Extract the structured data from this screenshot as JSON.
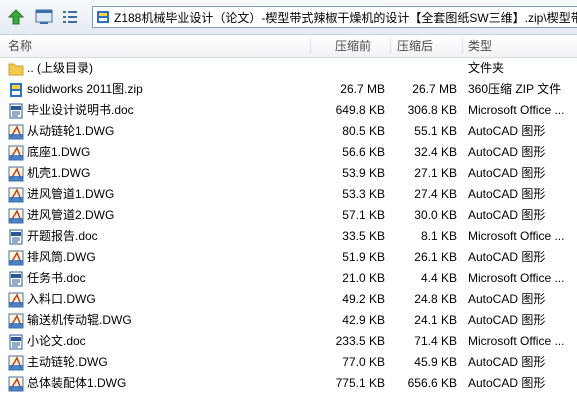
{
  "toolbar": {
    "up_icon": "up-arrow-icon",
    "view_icon": "window-icon",
    "details_icon": "details-view-icon",
    "path": "Z188机械毕业设计（论文）-楔型带式辣椒干燥机的设计【全套图纸SW三维】.zip\\楔型带"
  },
  "columns": {
    "name": "名称",
    "packed": "压缩前",
    "size": "压缩后",
    "type": "类型"
  },
  "rows": [
    {
      "icon": "folder-icon",
      "name": ".. (上级目录)",
      "packed": "",
      "size": "",
      "type": "文件夹"
    },
    {
      "icon": "zip-icon",
      "name": "solidworks 2011图.zip",
      "packed": "26.7 MB",
      "size": "26.7 MB",
      "type": "360压缩 ZIP 文件"
    },
    {
      "icon": "doc-icon",
      "name": "毕业设计说明书.doc",
      "packed": "649.8 KB",
      "size": "306.8 KB",
      "type": "Microsoft Office ..."
    },
    {
      "icon": "dwg-icon",
      "name": "从动链轮1.DWG",
      "packed": "80.5 KB",
      "size": "55.1 KB",
      "type": "AutoCAD 图形"
    },
    {
      "icon": "dwg-icon",
      "name": "底座1.DWG",
      "packed": "56.6 KB",
      "size": "32.4 KB",
      "type": "AutoCAD 图形"
    },
    {
      "icon": "dwg-icon",
      "name": "机壳1.DWG",
      "packed": "53.9 KB",
      "size": "27.1 KB",
      "type": "AutoCAD 图形"
    },
    {
      "icon": "dwg-icon",
      "name": "进风管道1.DWG",
      "packed": "53.3 KB",
      "size": "27.4 KB",
      "type": "AutoCAD 图形"
    },
    {
      "icon": "dwg-icon",
      "name": "进风管道2.DWG",
      "packed": "57.1 KB",
      "size": "30.0 KB",
      "type": "AutoCAD 图形"
    },
    {
      "icon": "doc-icon",
      "name": "开题报告.doc",
      "packed": "33.5 KB",
      "size": "8.1 KB",
      "type": "Microsoft Office ..."
    },
    {
      "icon": "dwg-icon",
      "name": "排风筒.DWG",
      "packed": "51.9 KB",
      "size": "26.1 KB",
      "type": "AutoCAD 图形"
    },
    {
      "icon": "doc-icon",
      "name": "任务书.doc",
      "packed": "21.0 KB",
      "size": "4.4 KB",
      "type": "Microsoft Office ..."
    },
    {
      "icon": "dwg-icon",
      "name": "入料口.DWG",
      "packed": "49.2 KB",
      "size": "24.8 KB",
      "type": "AutoCAD 图形"
    },
    {
      "icon": "dwg-icon",
      "name": "输送机传动辊.DWG",
      "packed": "42.9 KB",
      "size": "24.1 KB",
      "type": "AutoCAD 图形"
    },
    {
      "icon": "doc-icon",
      "name": "小论文.doc",
      "packed": "233.5 KB",
      "size": "71.4 KB",
      "type": "Microsoft Office ..."
    },
    {
      "icon": "dwg-icon",
      "name": "主动链轮.DWG",
      "packed": "77.0 KB",
      "size": "45.9 KB",
      "type": "AutoCAD 图形"
    },
    {
      "icon": "dwg-icon",
      "name": "总体装配体1.DWG",
      "packed": "775.1 KB",
      "size": "656.6 KB",
      "type": "AutoCAD 图形"
    }
  ]
}
